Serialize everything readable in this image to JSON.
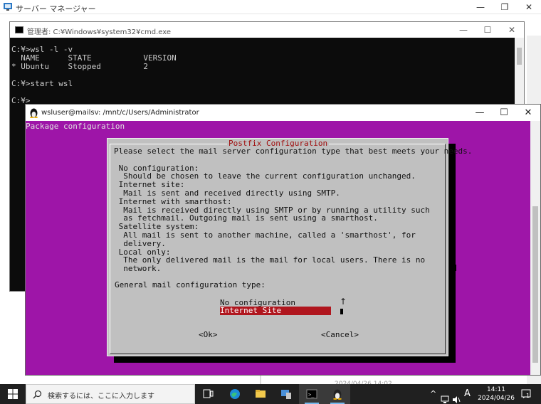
{
  "server_manager": {
    "title": "サーバー マネージャー",
    "status_fragment": "2024/04/26 14:02"
  },
  "window_controls": {
    "minimize": "—",
    "restore": "❐",
    "close": "✕"
  },
  "cmd_window": {
    "title": "管理者: C:¥Windows¥system32¥cmd.exe",
    "lines": [
      "C:¥>wsl -l -v",
      "  NAME      STATE           VERSION",
      "* Ubuntu    Stopped         2",
      "",
      "C:¥>start wsl",
      "",
      "C:¥>"
    ]
  },
  "wsl_window": {
    "title": "wsluser@mailsv: /mnt/c/Users/Administrator",
    "package_configuration": "Package configuration"
  },
  "dialog": {
    "title": "Postfix Configuration",
    "description": "Please select the mail server configuration type that best meets your needs.\n\n No configuration:\n  Should be chosen to leave the current configuration unchanged.\n Internet site:\n  Mail is sent and received directly using SMTP.\n Internet with smarthost:\n  Mail is received directly using SMTP or by running a utility such\n  as fetchmail. Outgoing mail is sent using a smarthost.\n Satellite system:\n  All mail is sent to another machine, called a 'smarthost', for\n  delivery.\n Local only:\n  The only delivered mail is the mail for local users. There is no\n  network.",
    "prompt": "General mail configuration type:",
    "options": [
      "No configuration",
      "Internet Site"
    ],
    "selected_option": "Internet Site",
    "scroll_arrow": "↑",
    "ok_label": "<Ok>",
    "cancel_label": "<Cancel>"
  },
  "taskbar": {
    "search_placeholder": "検索するには、ここに入力します",
    "icons": [
      "task-view",
      "edge",
      "file-explorer",
      "server-manager",
      "command-prompt",
      "ubuntu"
    ],
    "tray": {
      "chevron": "^",
      "ime": "A",
      "time": "14:11",
      "date": "2024/04/26",
      "notifications": "1"
    }
  },
  "colors": {
    "ubuntu_purple": "#9e15a8",
    "dialog_gray": "#c0c0c0",
    "highlight_red": "#b0161e",
    "title_red": "#a01010",
    "taskbar": "#202020"
  }
}
